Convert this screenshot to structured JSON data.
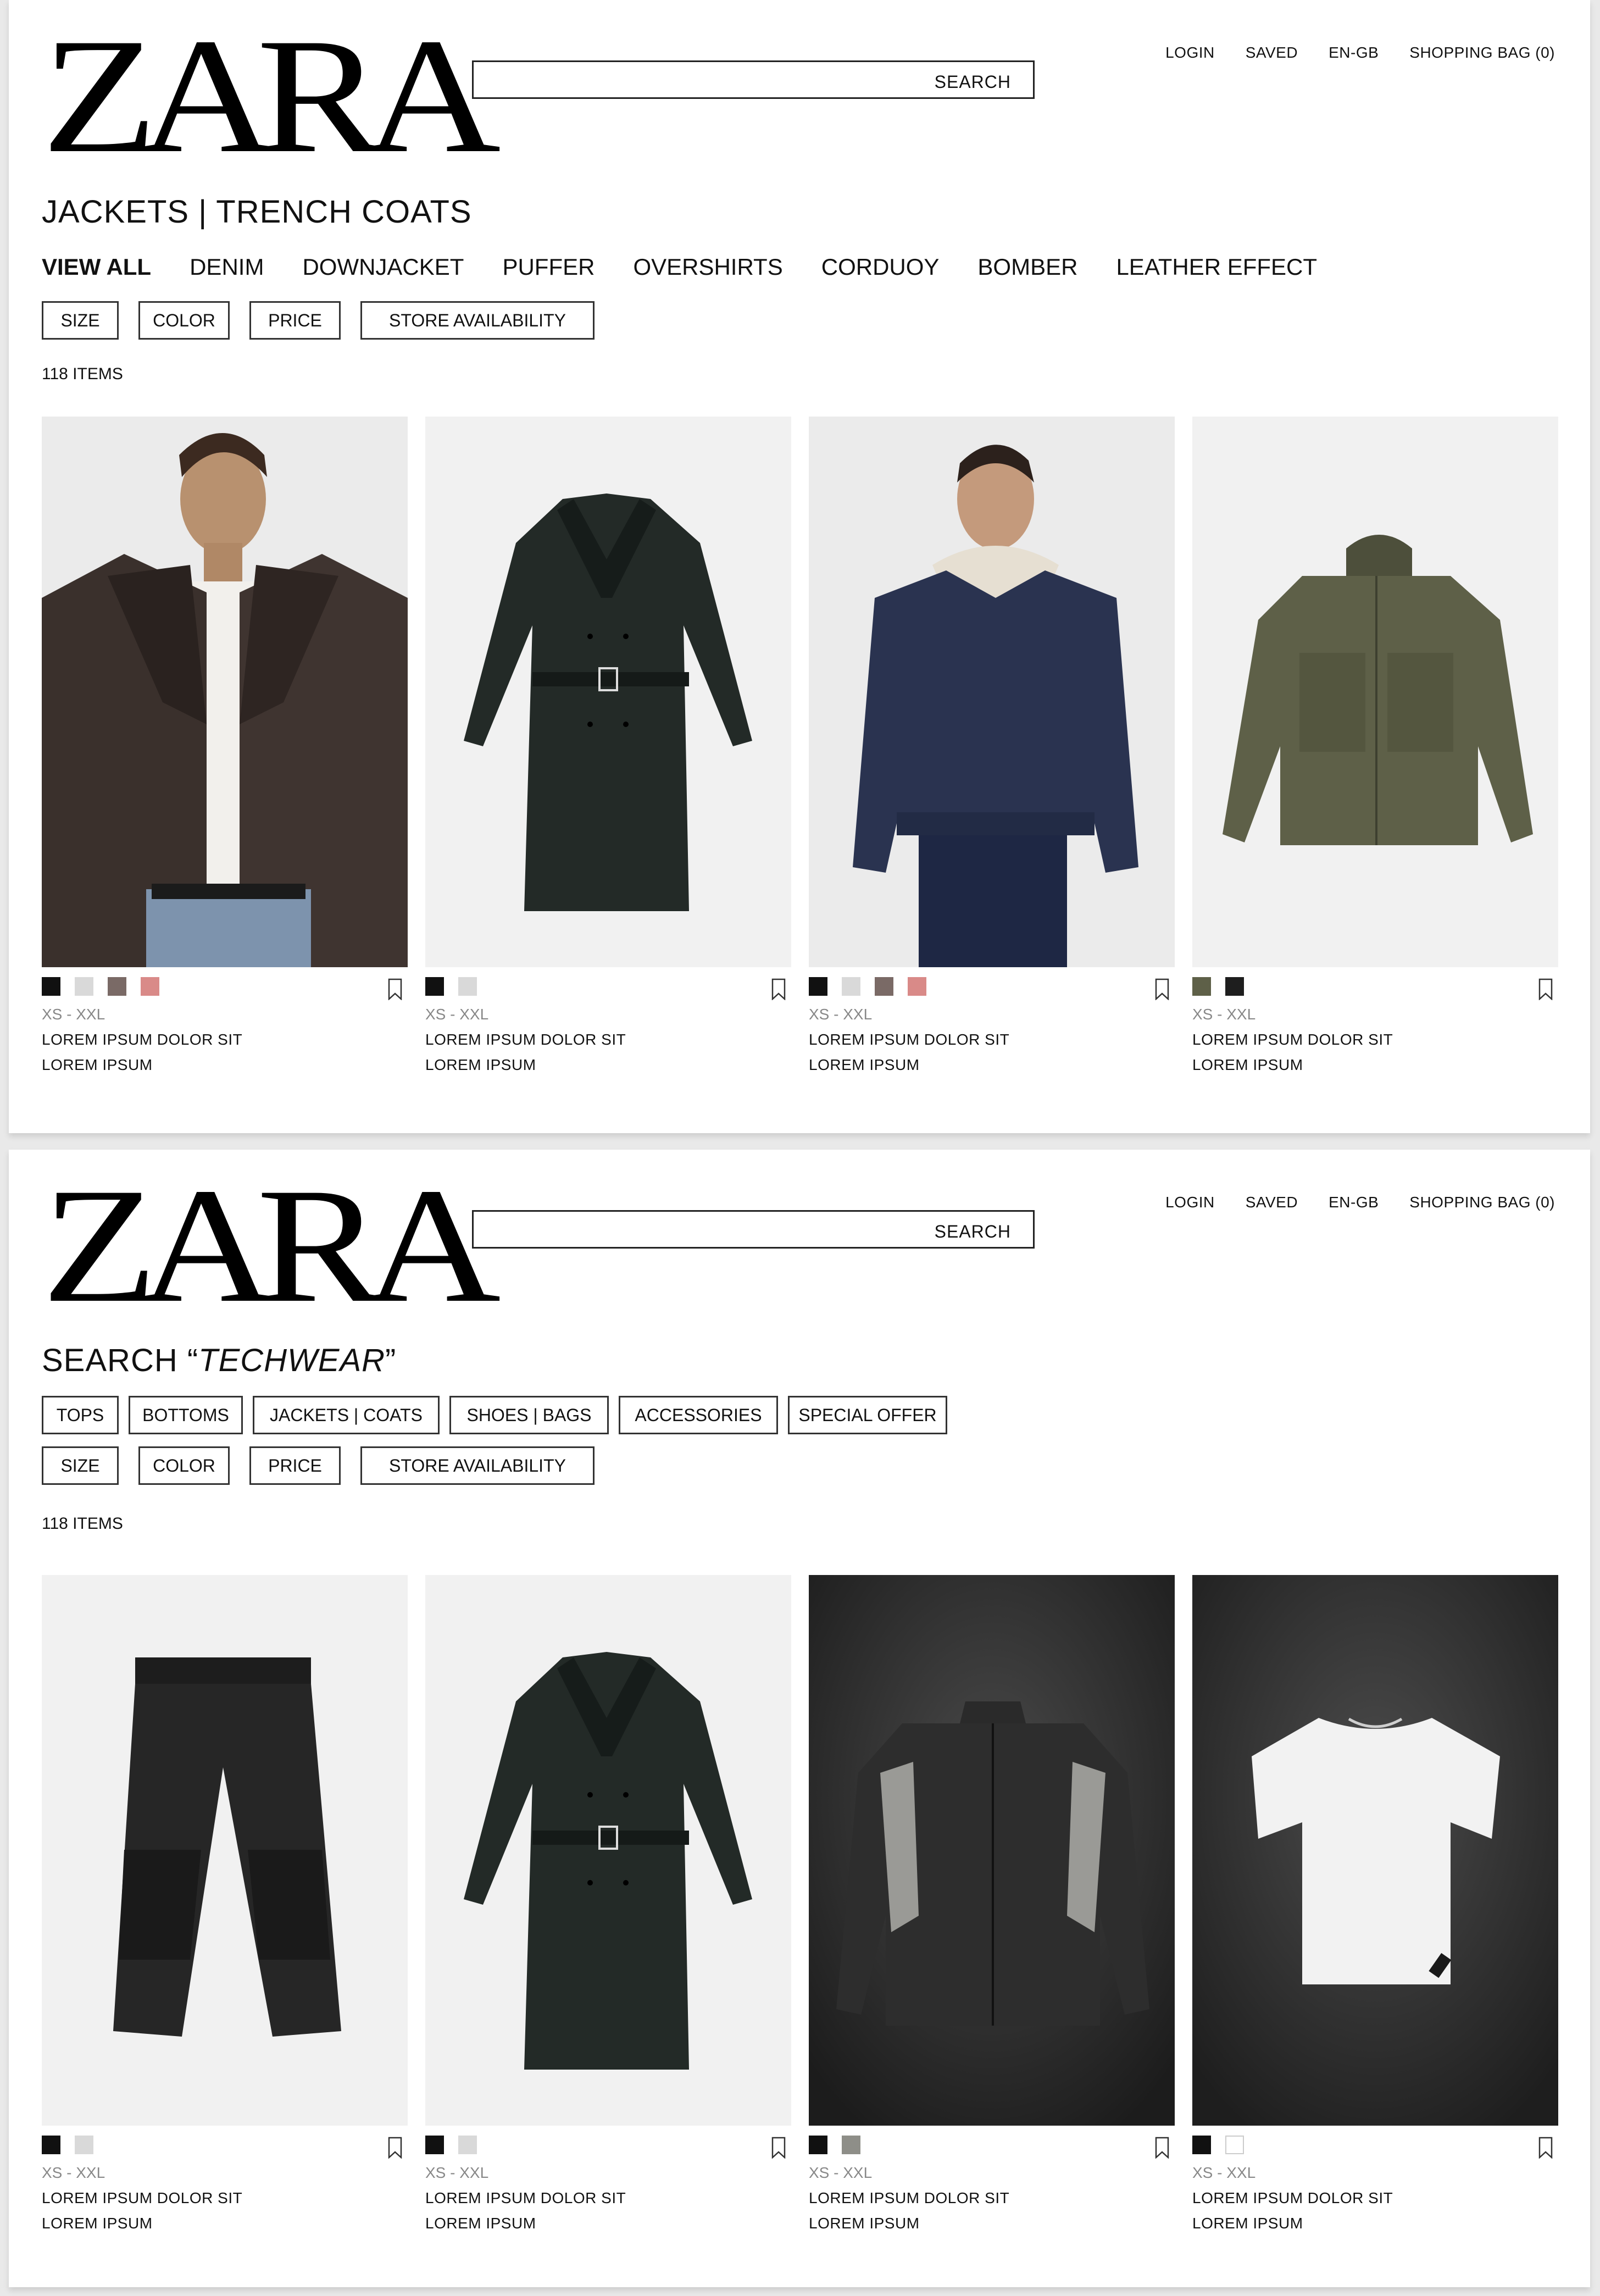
{
  "screens": [
    {
      "header": {
        "logo": "ZARA",
        "search_label": "SEARCH",
        "nav": [
          "LOGIN",
          "SAVED",
          "EN-GB",
          "SHOPPING BAG (0)"
        ]
      },
      "title": "JACKETS | TRENCH COATS",
      "category_tabs": [
        {
          "label": "VIEW ALL",
          "active": true
        },
        {
          "label": "DENIM"
        },
        {
          "label": "DOWNJACKET"
        },
        {
          "label": "PUFFER"
        },
        {
          "label": "OVERSHIRTS"
        },
        {
          "label": "CORDUOY"
        },
        {
          "label": "BOMBER"
        },
        {
          "label": "LEATHER EFFECT"
        }
      ],
      "filters": [
        "SIZE",
        "COLOR",
        "PRICE",
        "STORE AVAILABILITY"
      ],
      "item_count": "118 ITEMS",
      "products": [
        {
          "image": "leather-jacket-model",
          "colors": [
            "#111111",
            "#d9d9d9",
            "#7a6a66",
            "#d98a88"
          ],
          "sizes": "XS - XXL",
          "name": "LOREM IPSUM DOLOR SIT",
          "price": "LOREM IPSUM"
        },
        {
          "image": "trench-coat",
          "colors": [
            "#111111",
            "#d9d9d9"
          ],
          "sizes": "XS - XXL",
          "name": "LOREM IPSUM DOLOR SIT",
          "price": "LOREM IPSUM"
        },
        {
          "image": "denim-shearling-jacket-model",
          "colors": [
            "#111111",
            "#d9d9d9",
            "#7a6a66",
            "#d98a88"
          ],
          "sizes": "XS - XXL",
          "name": "LOREM IPSUM DOLOR SIT",
          "price": "LOREM IPSUM"
        },
        {
          "image": "olive-hooded-jacket",
          "colors": [
            "#5e6048",
            "#1e1e1e"
          ],
          "sizes": "XS - XXL",
          "name": "LOREM IPSUM DOLOR SIT",
          "price": "LOREM IPSUM"
        }
      ]
    },
    {
      "header": {
        "logo": "ZARA",
        "search_label": "SEARCH",
        "nav": [
          "LOGIN",
          "SAVED",
          "EN-GB",
          "SHOPPING BAG (0)"
        ]
      },
      "title_prefix": "SEARCH “",
      "title_query": "TECHWEAR",
      "title_suffix": "”",
      "categories": [
        "TOPS",
        "BOTTOMS",
        "JACKETS | COATS",
        "SHOES | BAGS",
        "ACCESSORIES",
        "SPECIAL OFFER"
      ],
      "filters": [
        "SIZE",
        "COLOR",
        "PRICE",
        "STORE AVAILABILITY"
      ],
      "item_count": "118 ITEMS",
      "products": [
        {
          "image": "black-cargo-pants",
          "colors": [
            "#111111",
            "#d9d9d9"
          ],
          "sizes": "XS - XXL",
          "name": "LOREM IPSUM DOLOR SIT",
          "price": "LOREM IPSUM"
        },
        {
          "image": "trench-coat",
          "colors": [
            "#111111",
            "#d9d9d9"
          ],
          "sizes": "XS - XXL",
          "name": "LOREM IPSUM DOLOR SIT",
          "price": "LOREM IPSUM"
        },
        {
          "image": "track-jacket-dark",
          "colors": [
            "#111111",
            "#8e8e88"
          ],
          "sizes": "XS - XXL",
          "name": "LOREM IPSUM DOLOR SIT",
          "price": "LOREM IPSUM"
        },
        {
          "image": "white-tshirt-dark",
          "colors": [
            "#111111",
            "#ffffff"
          ],
          "sizes": "XS - XXL",
          "name": "LOREM IPSUM DOLOR SIT",
          "price": "LOREM IPSUM"
        }
      ]
    }
  ]
}
